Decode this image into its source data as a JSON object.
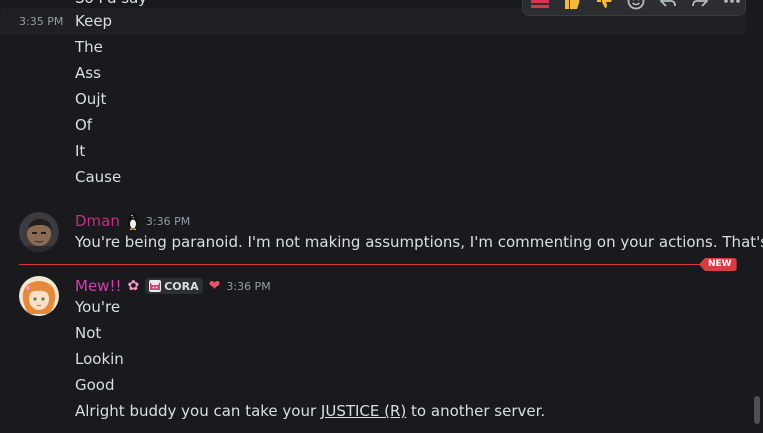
{
  "message_group_1": {
    "cutoff_text": "So I'd say",
    "hover_timestamp": "3:35 PM",
    "lines": [
      "Keep",
      "The",
      "Ass",
      "Oujt",
      "Of",
      "It",
      "Cause"
    ]
  },
  "toolbar": {
    "icons": [
      "fire-reaction-icon",
      "thumbs-up-icon",
      "thumbs-down-icon",
      "add-reaction-icon",
      "reply-icon",
      "forward-icon",
      "more-icon"
    ]
  },
  "message_dman": {
    "username": "Dman",
    "username_color": "#c0307f",
    "timestamp": "3:36 PM",
    "text": "You're being paranoid. I'm not making assumptions, I'm commenting on your actions. That's it."
  },
  "new_divider": {
    "label": "NEW",
    "color": "#d83c3e"
  },
  "message_mew": {
    "username": "Mew!!",
    "username_color": "#d63fae",
    "tag": "CORA",
    "timestamp": "3:36 PM",
    "lines": [
      "You're",
      "Not",
      "Lookin",
      "Good"
    ],
    "last_line_prefix": "Alright buddy you can take your ",
    "last_line_link": "JUSTICE (R)",
    "last_line_suffix": " to another server."
  }
}
